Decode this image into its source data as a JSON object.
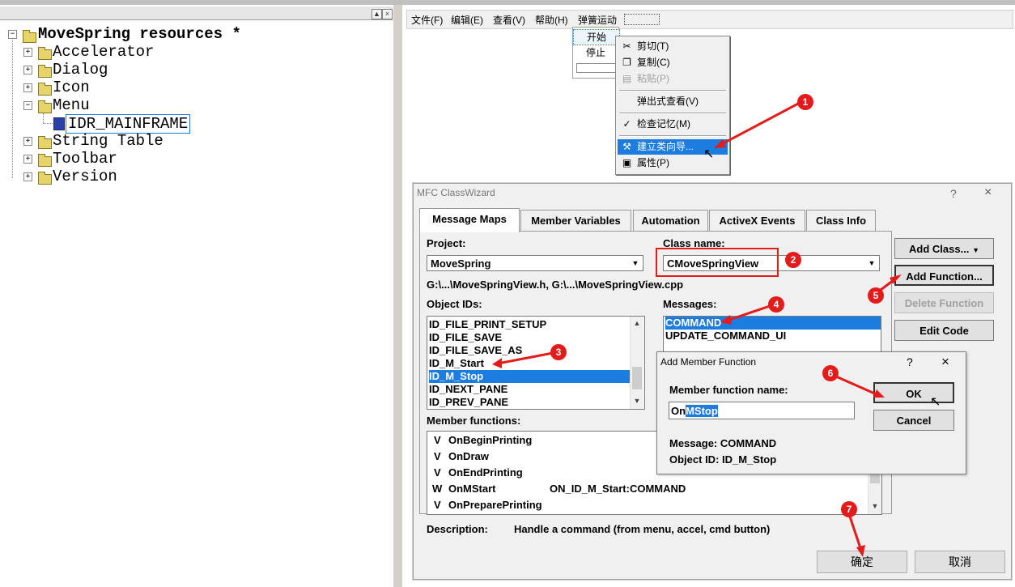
{
  "tree": {
    "root": "MoveSpring resources *",
    "items": [
      "Accelerator",
      "Dialog",
      "Icon",
      "Menu",
      "String Table",
      "Toolbar",
      "Version"
    ],
    "menu_child": "IDR_MAINFRAME",
    "header_buttons": [
      "▲",
      "×"
    ]
  },
  "menu_editor": {
    "menus": [
      "文件(F)",
      "编辑(E)",
      "查看(V)",
      "帮助(H)",
      "弹簧运动"
    ],
    "submenu": [
      "开始",
      "停止"
    ]
  },
  "context_menu": {
    "items": [
      {
        "label": "剪切(T)",
        "icon": "scissors-icon",
        "state": "normal"
      },
      {
        "label": "复制(C)",
        "icon": "copy-icon",
        "state": "normal"
      },
      {
        "label": "粘贴(P)",
        "icon": "paste-icon",
        "state": "disabled"
      },
      {
        "label": "弹出式查看(V)",
        "icon": "",
        "state": "normal"
      },
      {
        "label": "检查记忆(M)",
        "icon": "check-icon",
        "state": "normal"
      },
      {
        "label": "建立类向导...",
        "icon": "wizard-icon",
        "state": "selected"
      },
      {
        "label": "属性(P)",
        "icon": "properties-icon",
        "state": "normal"
      }
    ]
  },
  "classwizard": {
    "title": "MFC ClassWizard",
    "help": "?",
    "close": "×",
    "tabs": [
      "Message Maps",
      "Member Variables",
      "Automation",
      "ActiveX Events",
      "Class Info"
    ],
    "project_label": "Project:",
    "project_value": "MoveSpring",
    "class_label": "Class name:",
    "class_value": "CMoveSpringView",
    "files": "G:\\...\\MoveSpringView.h, G:\\...\\MoveSpringView.cpp",
    "object_ids_label": "Object IDs:",
    "object_ids": [
      "ID_FILE_PRINT_SETUP",
      "ID_FILE_SAVE",
      "ID_FILE_SAVE_AS",
      "ID_M_Start",
      "ID_M_Stop",
      "ID_NEXT_PANE",
      "ID_PREV_PANE"
    ],
    "object_ids_selected": 4,
    "messages_label": "Messages:",
    "messages": [
      "COMMAND",
      "UPDATE_COMMAND_UI"
    ],
    "messages_selected": 0,
    "member_functions_label": "Member functions:",
    "member_functions": [
      {
        "type": "V",
        "name": "OnBeginPrinting",
        "map": ""
      },
      {
        "type": "V",
        "name": "OnDraw",
        "map": ""
      },
      {
        "type": "V",
        "name": "OnEndPrinting",
        "map": ""
      },
      {
        "type": "W",
        "name": "OnMStart",
        "map": "ON_ID_M_Start:COMMAND"
      },
      {
        "type": "V",
        "name": "OnPreparePrinting",
        "map": ""
      }
    ],
    "description_label": "Description:",
    "description": "Handle a command (from menu, accel, cmd button)",
    "buttons": {
      "add_class": "Add Class...",
      "add_function": "Add Function...",
      "delete_function": "Delete Function",
      "edit_code": "Edit Code",
      "ok": "确定",
      "cancel": "取消"
    }
  },
  "add_member_function": {
    "title": "Add Member Function",
    "help": "?",
    "close": "×",
    "name_label": "Member function name:",
    "name_prefix": "On",
    "name_selected": "MStop",
    "message": "Message: COMMAND",
    "object_id": "Object ID: ID_M_Stop",
    "ok": "OK",
    "cancel": "Cancel"
  },
  "markers": [
    "1",
    "2",
    "3",
    "4",
    "5",
    "6",
    "7"
  ],
  "colors": {
    "highlight": "#1c7ce0",
    "annotation": "#e31b1b"
  }
}
